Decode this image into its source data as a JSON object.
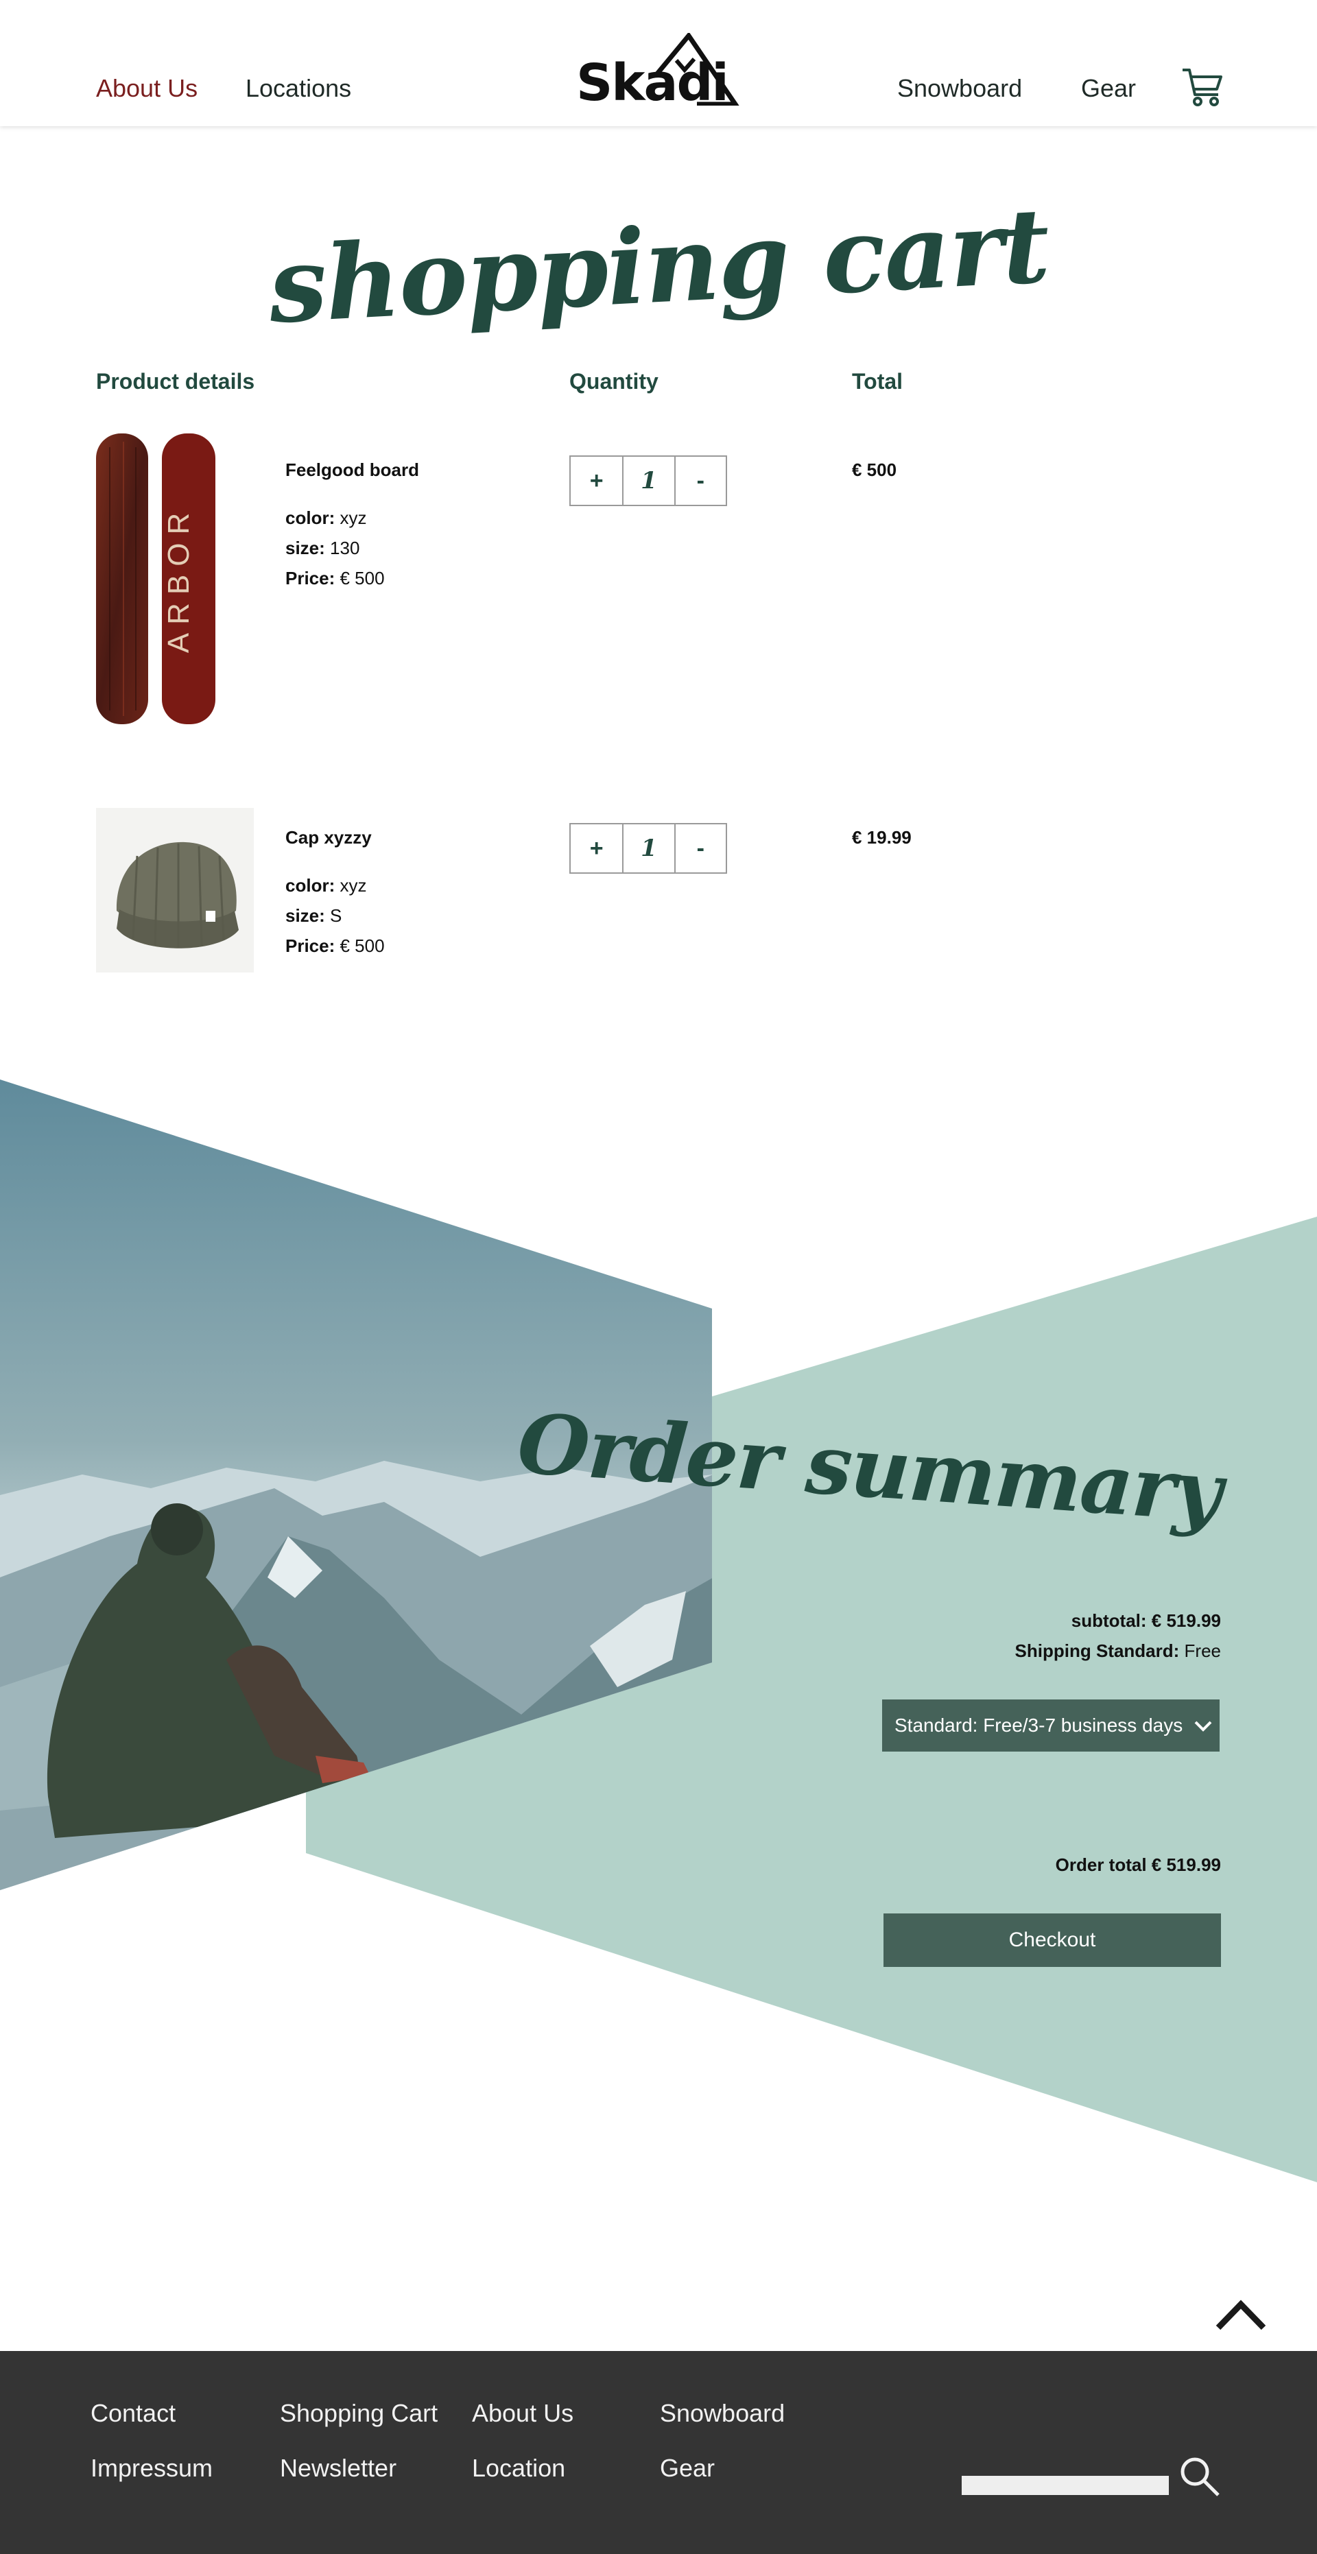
{
  "header": {
    "nav_left": [
      "About Us",
      "Locations"
    ],
    "logo_text": "Skadi",
    "nav_right": [
      "Snowboard",
      "Gear"
    ],
    "icons": {
      "cart": "cart-icon"
    }
  },
  "page": {
    "title": "shopping cart"
  },
  "columns": {
    "product": "Product details",
    "quantity": "Quantity",
    "total": "Total"
  },
  "products": [
    {
      "name": "Feelgood board",
      "image_text": "ARBOR",
      "color_label": "color:",
      "color": "xyz",
      "size_label": "size:",
      "size": "130",
      "price_label": "Price:",
      "price": "€ 500",
      "qty": "1",
      "total": "€ 500"
    },
    {
      "name": "Cap xyzzy",
      "color_label": "color:",
      "color": "xyz",
      "size_label": "size:",
      "size": "S",
      "price_label": "Price:",
      "price": "€ 500",
      "qty": "1",
      "total": "€ 19.99"
    }
  ],
  "stepper": {
    "plus": "+",
    "minus": "-"
  },
  "summary": {
    "title": "Order summary",
    "subtotal": "subtotal: € 519.99",
    "shipping_label": "Shipping Standard:",
    "shipping_value": "Free",
    "shipping_select": "Standard: Free/3-7 business days",
    "order_total": "Order total € 519.99",
    "checkout": "Checkout"
  },
  "footer": {
    "col1": [
      "Contact",
      "Impressum"
    ],
    "col2": [
      "Shopping Cart",
      "Newsletter"
    ],
    "col3": [
      "About Us",
      "Location"
    ],
    "col4": [
      "Snowboard",
      "Gear"
    ],
    "search_placeholder": ""
  },
  "colors": {
    "accent": "#224a3f",
    "button": "#456259",
    "mint": "#b3d2c9",
    "nav_active": "#7a1f1f",
    "footer_bg": "#343434"
  }
}
